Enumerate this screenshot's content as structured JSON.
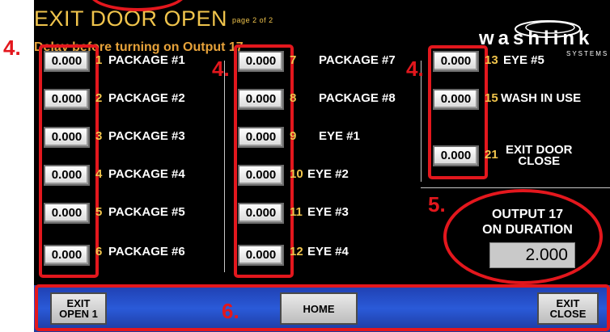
{
  "header": {
    "title": "EXIT DOOR OPEN",
    "page_indicator": "page 2 of 2",
    "subtitle": "Delay before turning on Output 17"
  },
  "logo": {
    "text": "washlink",
    "subtext": "SYSTEMS"
  },
  "column1": [
    {
      "value": "0.000",
      "num": "1",
      "label": "PACKAGE #1"
    },
    {
      "value": "0.000",
      "num": "2",
      "label": "PACKAGE #2"
    },
    {
      "value": "0.000",
      "num": "3",
      "label": "PACKAGE #3"
    },
    {
      "value": "0.000",
      "num": "4",
      "label": "PACKAGE #4"
    },
    {
      "value": "0.000",
      "num": "5",
      "label": "PACKAGE #5"
    },
    {
      "value": "0.000",
      "num": "6",
      "label": "PACKAGE #6"
    }
  ],
  "column2": [
    {
      "value": "0.000",
      "num": "7",
      "label": "PACKAGE #7"
    },
    {
      "value": "0.000",
      "num": "8",
      "label": "PACKAGE #8"
    },
    {
      "value": "0.000",
      "num": "9",
      "label": "EYE #1"
    },
    {
      "value": "0.000",
      "num": "10",
      "label": "EYE #2"
    },
    {
      "value": "0.000",
      "num": "11",
      "label": "EYE #3"
    },
    {
      "value": "0.000",
      "num": "12",
      "label": "EYE #4"
    }
  ],
  "column3": [
    {
      "value": "0.000",
      "num": "13",
      "label": "EYE #5"
    },
    {
      "value": "0.000",
      "num": "15",
      "label": "WASH IN USE"
    },
    {
      "value": "0.000",
      "num": "21",
      "label_line1": "EXIT DOOR",
      "label_line2": "CLOSE"
    }
  ],
  "output": {
    "title_line1": "OUTPUT 17",
    "title_line2": "ON DURATION",
    "value": "2.000"
  },
  "annotations": {
    "marker_4a": "4.",
    "marker_4b": "4.",
    "marker_4c": "4.",
    "marker_5": "5.",
    "marker_6": "6."
  },
  "nav": {
    "exit_open_1": "EXIT\nOPEN 1",
    "home": "HOME",
    "exit_close": "EXIT\nCLOSE"
  },
  "colors": {
    "background": "#000000",
    "title": "#f0c44c",
    "number": "#f0c44c",
    "label": "#ffffff",
    "annotation": "#e3171d",
    "bottom_bar": "#2a5ad8"
  }
}
